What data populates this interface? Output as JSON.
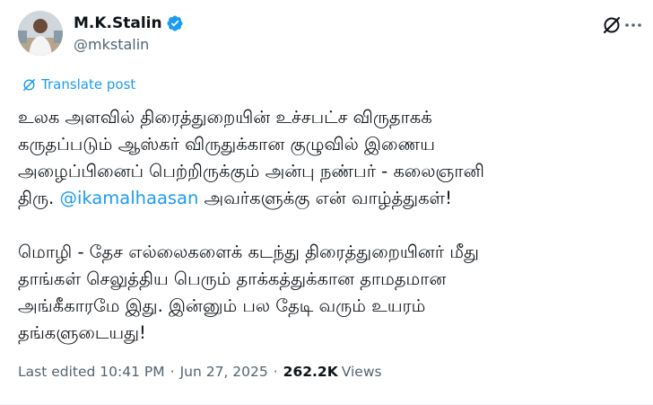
{
  "author": {
    "display_name": "M.K.Stalin",
    "handle": "@mkstalin",
    "verified": true
  },
  "icons": {
    "verified": "verified-badge-icon",
    "grok": "grok-icon",
    "more": "more-options-icon",
    "translate": "translate-icon"
  },
  "translate_label": "Translate post",
  "post": {
    "para1": {
      "line1": "உலக அளவில் திரைத்துறையின் உச்சபட்ச விருதாகக்",
      "line2": "கருதப்படும் ஆஸ்கர் விருதுக்கான குழுவில் இணைய",
      "line3": "அழைப்பினைப் பெற்றிருக்கும் அன்பு நண்பர் - கலைஞானி",
      "line4_prefix": "திரு. ",
      "mention": "@ikamalhaasan",
      "line4_suffix": " அவர்களுக்கு என் வாழ்த்துகள்!"
    },
    "para2": {
      "line1": "மொழி - தேச எல்லைகளைக் கடந்து திரைத்துறையினர் மீது",
      "line2": "தாங்கள் செலுத்திய பெரும் தாக்கத்துக்கான தாமதமான",
      "line3": "அங்கீகாரமே இது. இன்னும் பல தேடி வரும் உயரம்",
      "line4": "தங்களுடையது!"
    }
  },
  "meta": {
    "edited_prefix": "Last edited",
    "time": "10:41 PM",
    "date": "Jun 27, 2025",
    "separator": "·",
    "views_count": "262.2K",
    "views_label": "Views"
  },
  "colors": {
    "accent": "#1d9bf0",
    "text_primary": "#0f1419",
    "text_secondary": "#536471"
  }
}
